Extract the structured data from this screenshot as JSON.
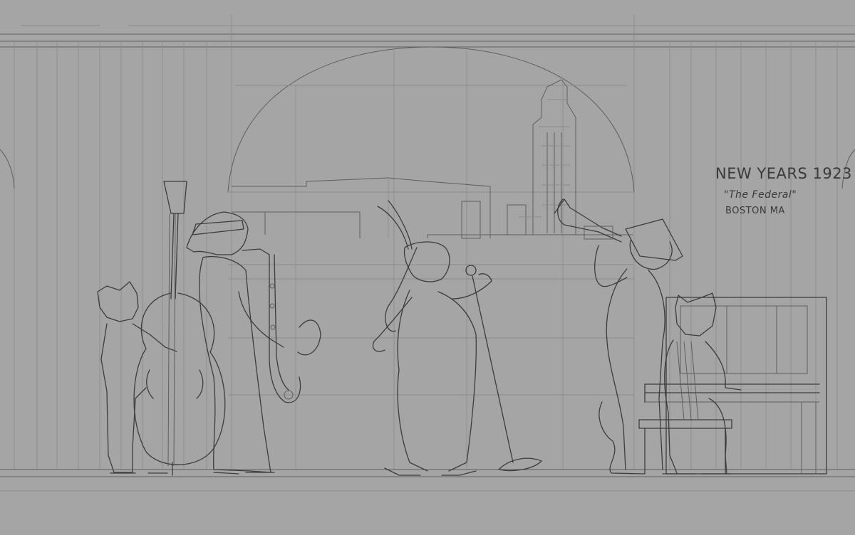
{
  "caption": {
    "title": "NEW YEARS 1923",
    "venue": "\"The Federal\"",
    "city": "BOSTON MA"
  },
  "colors": {
    "paper": "#a5a5a5",
    "guide_line": "#8c8c8c",
    "sketch_line": "#3c3c3c"
  }
}
